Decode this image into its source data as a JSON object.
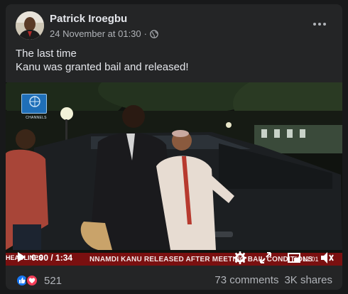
{
  "post": {
    "author_name": "Patrick Iroegbu",
    "timestamp": "24 November at 01:30",
    "separator": "·",
    "audience_icon": "globe-icon",
    "more_icon": "more-options-icon",
    "text_line_1": "The last time",
    "text_line_2": "Kanu was granted bail and released!"
  },
  "video": {
    "channel_logo_text": "CHANNELS",
    "ticker_tag": "HEADLINES",
    "ticker_text": "NNAMDI KANU RELEASED AFTER MEETING BAIL CONDITIONS",
    "ticker_time": "12:01",
    "current_time": "0:00 / 1:34",
    "controls": [
      "play-icon",
      "settings-icon",
      "fullscreen-icon",
      "picture-in-picture-icon",
      "volume-icon"
    ],
    "progress": 0
  },
  "footer": {
    "reaction_count": "521",
    "comments": "73 comments",
    "shares": "3K shares"
  },
  "colors": {
    "background": "#18191a",
    "card": "#242526",
    "like_blue": "#1877f2",
    "love_red": "#f33e58",
    "ticker_red": "#7a1010"
  }
}
